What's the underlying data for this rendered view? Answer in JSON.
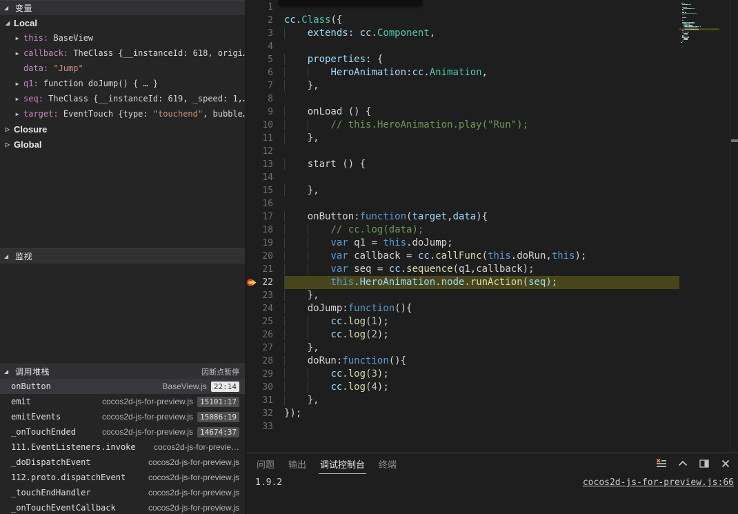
{
  "colors": {
    "editor_bg": "#1e1e1e",
    "sidebar_bg": "#252526",
    "section_header_bg": "#313134",
    "current_line_highlight": "#48451c",
    "keyword": "#569cd6",
    "variable": "#9cdcfe",
    "class_name": "#4ec9b0",
    "function_name": "#dcdcaa",
    "comment": "#6a9955",
    "number": "#b5cea8",
    "string": "#ce9178",
    "debug_var_name": "#c586c0",
    "breakpoint_red": "#d43b3b",
    "paused_arrow_yellow": "#ffcc33"
  },
  "sidebar": {
    "variables_label": "变量",
    "scope_local": "Local",
    "scope_closure": "Closure",
    "scope_global": "Global",
    "variables": [
      {
        "name": "this",
        "expandable": true,
        "value": [
          [
            "plain",
            "BaseView"
          ]
        ]
      },
      {
        "name": "callback",
        "expandable": true,
        "value": [
          [
            "plain",
            "TheClass {__instanceId: 618, origi…"
          ]
        ]
      },
      {
        "name": "data",
        "expandable": false,
        "value": [
          [
            "str",
            "\"Jump\""
          ]
        ]
      },
      {
        "name": "q1",
        "expandable": true,
        "value": [
          [
            "plain",
            "function doJump() { … }"
          ]
        ]
      },
      {
        "name": "seq",
        "expandable": true,
        "value": [
          [
            "plain",
            "TheClass {__instanceId: 619, _speed: 1,…"
          ]
        ]
      },
      {
        "name": "target",
        "expandable": true,
        "value": [
          [
            "plain",
            "EventTouch {type: "
          ],
          [
            "str",
            "\"touchend\""
          ],
          [
            "plain",
            ", bubble…"
          ]
        ]
      }
    ],
    "watch_label": "监视",
    "callstack_label": "调用堆栈",
    "paused_label": "因断点暂停",
    "callstack": [
      {
        "fn": "onButton",
        "file": "BaseView.js",
        "pos": "22:14",
        "selected": true,
        "badge_light": true
      },
      {
        "fn": "emit",
        "file": "cocos2d-js-for-preview.js",
        "pos": "15101:17",
        "selected": false
      },
      {
        "fn": "emitEvents",
        "file": "cocos2d-js-for-preview.js",
        "pos": "15086:19",
        "selected": false
      },
      {
        "fn": "_onTouchEnded",
        "file": "cocos2d-js-for-preview.js",
        "pos": "14674:37",
        "selected": false
      },
      {
        "fn": "111.EventListeners.invoke",
        "file": "cocos2d-js-for-previe…",
        "pos": "",
        "selected": false
      },
      {
        "fn": "_doDispatchEvent",
        "file": "cocos2d-js-for-preview.js",
        "pos": "",
        "selected": false
      },
      {
        "fn": "112.proto.dispatchEvent",
        "file": "cocos2d-js-for-preview.js",
        "pos": "",
        "selected": false
      },
      {
        "fn": "_touchEndHandler",
        "file": "cocos2d-js-for-preview.js",
        "pos": "",
        "selected": false
      },
      {
        "fn": "_onTouchEventCallback",
        "file": "cocos2d-js-for-preview.js",
        "pos": "",
        "selected": false
      }
    ]
  },
  "editor": {
    "breakpoint_line": 22,
    "current_line": 22,
    "lines": [
      {
        "n": 1,
        "t": []
      },
      {
        "n": 2,
        "t": [
          [
            "prop",
            "cc"
          ],
          [
            "pun",
            "."
          ],
          [
            "cls",
            "Class"
          ],
          [
            "pun",
            "({"
          ]
        ]
      },
      {
        "n": 3,
        "t": [
          [
            "lead",
            "    "
          ],
          [
            "prop",
            "extends"
          ],
          [
            "pun",
            ": "
          ],
          [
            "prop",
            "cc"
          ],
          [
            "pun",
            "."
          ],
          [
            "cls",
            "Component"
          ],
          [
            "pun",
            ","
          ]
        ]
      },
      {
        "n": 4,
        "t": []
      },
      {
        "n": 5,
        "t": [
          [
            "lead",
            "    "
          ],
          [
            "prop",
            "properties"
          ],
          [
            "pun",
            ": {"
          ]
        ]
      },
      {
        "n": 6,
        "t": [
          [
            "lead",
            "        "
          ],
          [
            "prop",
            "HeroAnimation"
          ],
          [
            "pun",
            ":"
          ],
          [
            "prop",
            "cc"
          ],
          [
            "pun",
            "."
          ],
          [
            "cls",
            "Animation"
          ],
          [
            "pun",
            ","
          ]
        ]
      },
      {
        "n": 7,
        "t": [
          [
            "lead",
            "    "
          ],
          [
            "pun",
            "},"
          ]
        ]
      },
      {
        "n": 8,
        "t": []
      },
      {
        "n": 9,
        "t": [
          [
            "lead",
            "    "
          ],
          [
            "plain",
            "onLoad"
          ],
          [
            "pun",
            " () {"
          ]
        ]
      },
      {
        "n": 10,
        "t": [
          [
            "lead",
            "        "
          ],
          [
            "cm",
            "// this.HeroAnimation.play(\"Run\");"
          ]
        ]
      },
      {
        "n": 11,
        "t": [
          [
            "lead",
            "    "
          ],
          [
            "pun",
            "},"
          ]
        ]
      },
      {
        "n": 12,
        "t": []
      },
      {
        "n": 13,
        "t": [
          [
            "lead",
            "    "
          ],
          [
            "plain",
            "start"
          ],
          [
            "pun",
            " () {"
          ]
        ]
      },
      {
        "n": 14,
        "t": []
      },
      {
        "n": 15,
        "t": [
          [
            "lead",
            "    "
          ],
          [
            "pun",
            "},"
          ]
        ]
      },
      {
        "n": 16,
        "t": []
      },
      {
        "n": 17,
        "t": [
          [
            "lead",
            "    "
          ],
          [
            "plain",
            "onButton"
          ],
          [
            "pun",
            ":"
          ],
          [
            "kw",
            "function"
          ],
          [
            "pun",
            "("
          ],
          [
            "prop",
            "target"
          ],
          [
            "pun",
            ","
          ],
          [
            "prop",
            "data"
          ],
          [
            "pun",
            "){"
          ]
        ]
      },
      {
        "n": 18,
        "t": [
          [
            "lead",
            "        "
          ],
          [
            "cm",
            "// cc.log(data);"
          ]
        ]
      },
      {
        "n": 19,
        "t": [
          [
            "lead",
            "        "
          ],
          [
            "kw",
            "var"
          ],
          [
            "pun",
            " "
          ],
          [
            "plain",
            "q1"
          ],
          [
            "pun",
            " = "
          ],
          [
            "kw",
            "this"
          ],
          [
            "pun",
            "."
          ],
          [
            "plain",
            "doJump"
          ],
          [
            "pun",
            ";"
          ]
        ]
      },
      {
        "n": 20,
        "t": [
          [
            "lead",
            "        "
          ],
          [
            "kw",
            "var"
          ],
          [
            "pun",
            " "
          ],
          [
            "plain",
            "callback"
          ],
          [
            "pun",
            " = "
          ],
          [
            "prop",
            "cc"
          ],
          [
            "pun",
            "."
          ],
          [
            "fn",
            "callFunc"
          ],
          [
            "pun",
            "("
          ],
          [
            "kw",
            "this"
          ],
          [
            "pun",
            "."
          ],
          [
            "plain",
            "doRun"
          ],
          [
            "pun",
            ","
          ],
          [
            "kw",
            "this"
          ],
          [
            "pun",
            ");"
          ]
        ]
      },
      {
        "n": 21,
        "t": [
          [
            "lead",
            "        "
          ],
          [
            "kw",
            "var"
          ],
          [
            "pun",
            " "
          ],
          [
            "plain",
            "seq"
          ],
          [
            "pun",
            " = "
          ],
          [
            "prop",
            "cc"
          ],
          [
            "pun",
            "."
          ],
          [
            "fn",
            "sequence"
          ],
          [
            "pun",
            "("
          ],
          [
            "plain",
            "q1"
          ],
          [
            "pun",
            ","
          ],
          [
            "plain",
            "callback"
          ],
          [
            "pun",
            ");"
          ]
        ]
      },
      {
        "n": 22,
        "t": [
          [
            "lead",
            "        "
          ],
          [
            "kw",
            "this"
          ],
          [
            "pun",
            "."
          ],
          [
            "prop",
            "HeroAnimation"
          ],
          [
            "pun",
            "."
          ],
          [
            "prop",
            "node"
          ],
          [
            "pun",
            "."
          ],
          [
            "fn",
            "runAction"
          ],
          [
            "pun",
            "("
          ],
          [
            "prop",
            "seq"
          ],
          [
            "pun",
            ");"
          ]
        ]
      },
      {
        "n": 23,
        "t": [
          [
            "lead",
            "    "
          ],
          [
            "pun",
            "},"
          ]
        ]
      },
      {
        "n": 24,
        "t": [
          [
            "lead",
            "    "
          ],
          [
            "plain",
            "doJump"
          ],
          [
            "pun",
            ":"
          ],
          [
            "kw",
            "function"
          ],
          [
            "pun",
            "(){"
          ]
        ]
      },
      {
        "n": 25,
        "t": [
          [
            "lead",
            "        "
          ],
          [
            "prop",
            "cc"
          ],
          [
            "pun",
            "."
          ],
          [
            "fn",
            "log"
          ],
          [
            "pun",
            "("
          ],
          [
            "num",
            "1"
          ],
          [
            "pun",
            ");"
          ]
        ]
      },
      {
        "n": 26,
        "t": [
          [
            "lead",
            "        "
          ],
          [
            "prop",
            "cc"
          ],
          [
            "pun",
            "."
          ],
          [
            "fn",
            "log"
          ],
          [
            "pun",
            "("
          ],
          [
            "num",
            "2"
          ],
          [
            "pun",
            ");"
          ]
        ]
      },
      {
        "n": 27,
        "t": [
          [
            "lead",
            "    "
          ],
          [
            "pun",
            "},"
          ]
        ]
      },
      {
        "n": 28,
        "t": [
          [
            "lead",
            "    "
          ],
          [
            "plain",
            "doRun"
          ],
          [
            "pun",
            ":"
          ],
          [
            "kw",
            "function"
          ],
          [
            "pun",
            "(){"
          ]
        ]
      },
      {
        "n": 29,
        "t": [
          [
            "lead",
            "        "
          ],
          [
            "prop",
            "cc"
          ],
          [
            "pun",
            "."
          ],
          [
            "fn",
            "log"
          ],
          [
            "pun",
            "("
          ],
          [
            "num",
            "3"
          ],
          [
            "pun",
            ");"
          ]
        ]
      },
      {
        "n": 30,
        "t": [
          [
            "lead",
            "        "
          ],
          [
            "prop",
            "cc"
          ],
          [
            "pun",
            "."
          ],
          [
            "fn",
            "log"
          ],
          [
            "pun",
            "("
          ],
          [
            "num",
            "4"
          ],
          [
            "pun",
            ");"
          ]
        ]
      },
      {
        "n": 31,
        "t": [
          [
            "lead",
            "    "
          ],
          [
            "pun",
            "},"
          ]
        ]
      },
      {
        "n": 32,
        "t": [
          [
            "pun",
            "});"
          ]
        ]
      },
      {
        "n": 33,
        "t": []
      }
    ]
  },
  "panel": {
    "tabs": [
      {
        "label": "问题",
        "active": false
      },
      {
        "label": "输出",
        "active": false
      },
      {
        "label": "调试控制台",
        "active": true
      },
      {
        "label": "终端",
        "active": false
      }
    ],
    "version_text": "1.9.2",
    "link_text": "cocos2d-js-for-preview.js:66",
    "action_icons": [
      "clear-console-icon",
      "chevron-up-icon",
      "split-panel-icon",
      "close-panel-icon"
    ]
  }
}
